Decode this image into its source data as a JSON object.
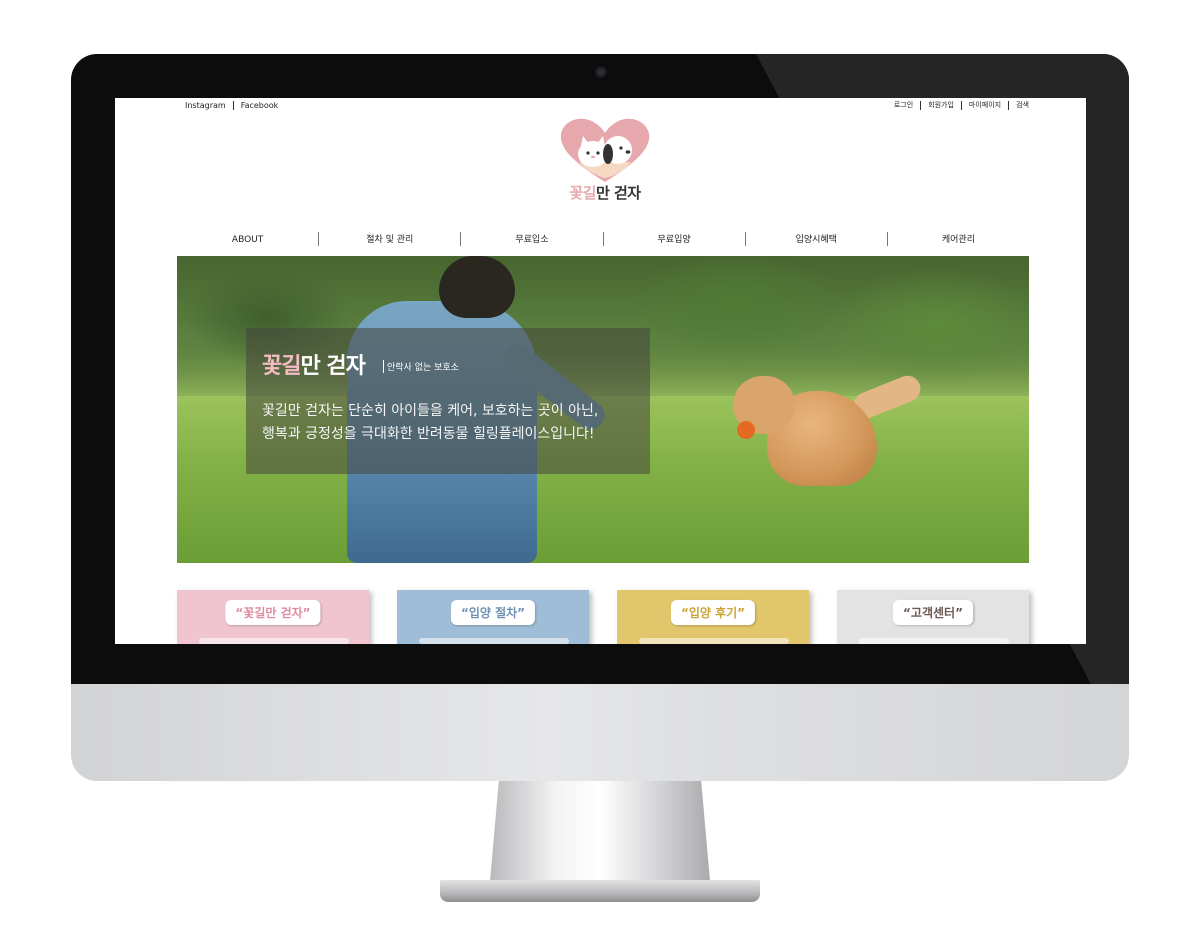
{
  "util_links_left": [
    "Instagram",
    "Facebook"
  ],
  "util_links_right": [
    "로그인",
    "회원가입",
    "마이페이지",
    "검색"
  ],
  "logo": {
    "text_pink": "꽃길",
    "text_dark": "만 걷자",
    "colors": {
      "heart": "#e7a8ad",
      "cat": "#ffffff",
      "dog_ear": "#333333"
    }
  },
  "nav": [
    "ABOUT",
    "절차 및 관리",
    "무료입소",
    "무료입양",
    "입양시혜택",
    "케어관리"
  ],
  "hero": {
    "title_pink": "꽃길",
    "title_white": "만 걷자",
    "subtitle": "안락사 없는 보호소",
    "desc_line1": "꽃길만 걷자는 단순히 아이들을 케어, 보호하는 곳이 아닌,",
    "desc_line2": "행복과 긍정성을 극대화한 반려동물 힐링플레이스입니다!"
  },
  "cards": [
    {
      "label": "“꽃길만 걷자”",
      "color": "#f0c5cf"
    },
    {
      "label": "“입양 절차”",
      "color": "#9fbdd6"
    },
    {
      "label": "“입양 후기”",
      "color": "#e2c66b"
    },
    {
      "label": "“고객센터”",
      "color": "#e3e3e3"
    }
  ]
}
